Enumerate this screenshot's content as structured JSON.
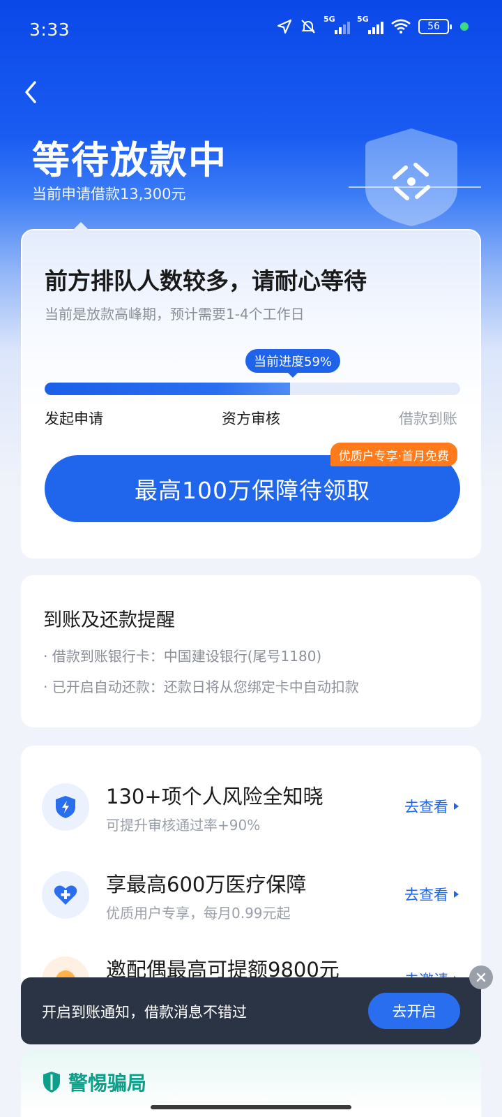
{
  "status_bar": {
    "time": "3:33",
    "network_1": "5G",
    "network_2": "5G",
    "battery": "56"
  },
  "header": {
    "title": "等待放款中",
    "subtitle": "当前申请借款13,300元"
  },
  "progress_card": {
    "title": "前方排队人数较多，请耐心等待",
    "subtitle": "当前是放款高峰期，预计需要1-4个工作日",
    "progress_label": "当前进度59%",
    "progress_value": 0.59,
    "steps": [
      "发起申请",
      "资方审核",
      "借款到账"
    ],
    "cta_label": "最高100万保障待领取",
    "promo_badge": "优质户专享·首月免费"
  },
  "reminder_card": {
    "title": "到账及还款提醒",
    "lines": [
      "· 借款到账银行卡：中国建设银行(尾号1180)",
      "· 已开启自动还款：还款日将从您绑定卡中自动扣款"
    ]
  },
  "services": [
    {
      "title": "130+项个人风险全知晓",
      "subtitle": "可提升审核通过率+90%",
      "link": "去查看",
      "icon": "shield-bolt-icon"
    },
    {
      "title": "享最高600万医疗保障",
      "subtitle": "优质用户专享，每月0.99元起",
      "link": "去查看",
      "icon": "heart-plus-icon"
    },
    {
      "title": "邀配偶最高可提额9800元",
      "subtitle": "",
      "link": "去邀请",
      "icon": "gift-icon"
    }
  ],
  "toast": {
    "text": "开启到账通知，借款消息不错过",
    "button": "去开启"
  },
  "fraud_card": {
    "title": "警惕骗局"
  },
  "colors": {
    "primary": "#1f66ec",
    "hero_top": "#0b48e8",
    "promo": "#ff7a1a",
    "fraud": "#0e9f8a"
  }
}
